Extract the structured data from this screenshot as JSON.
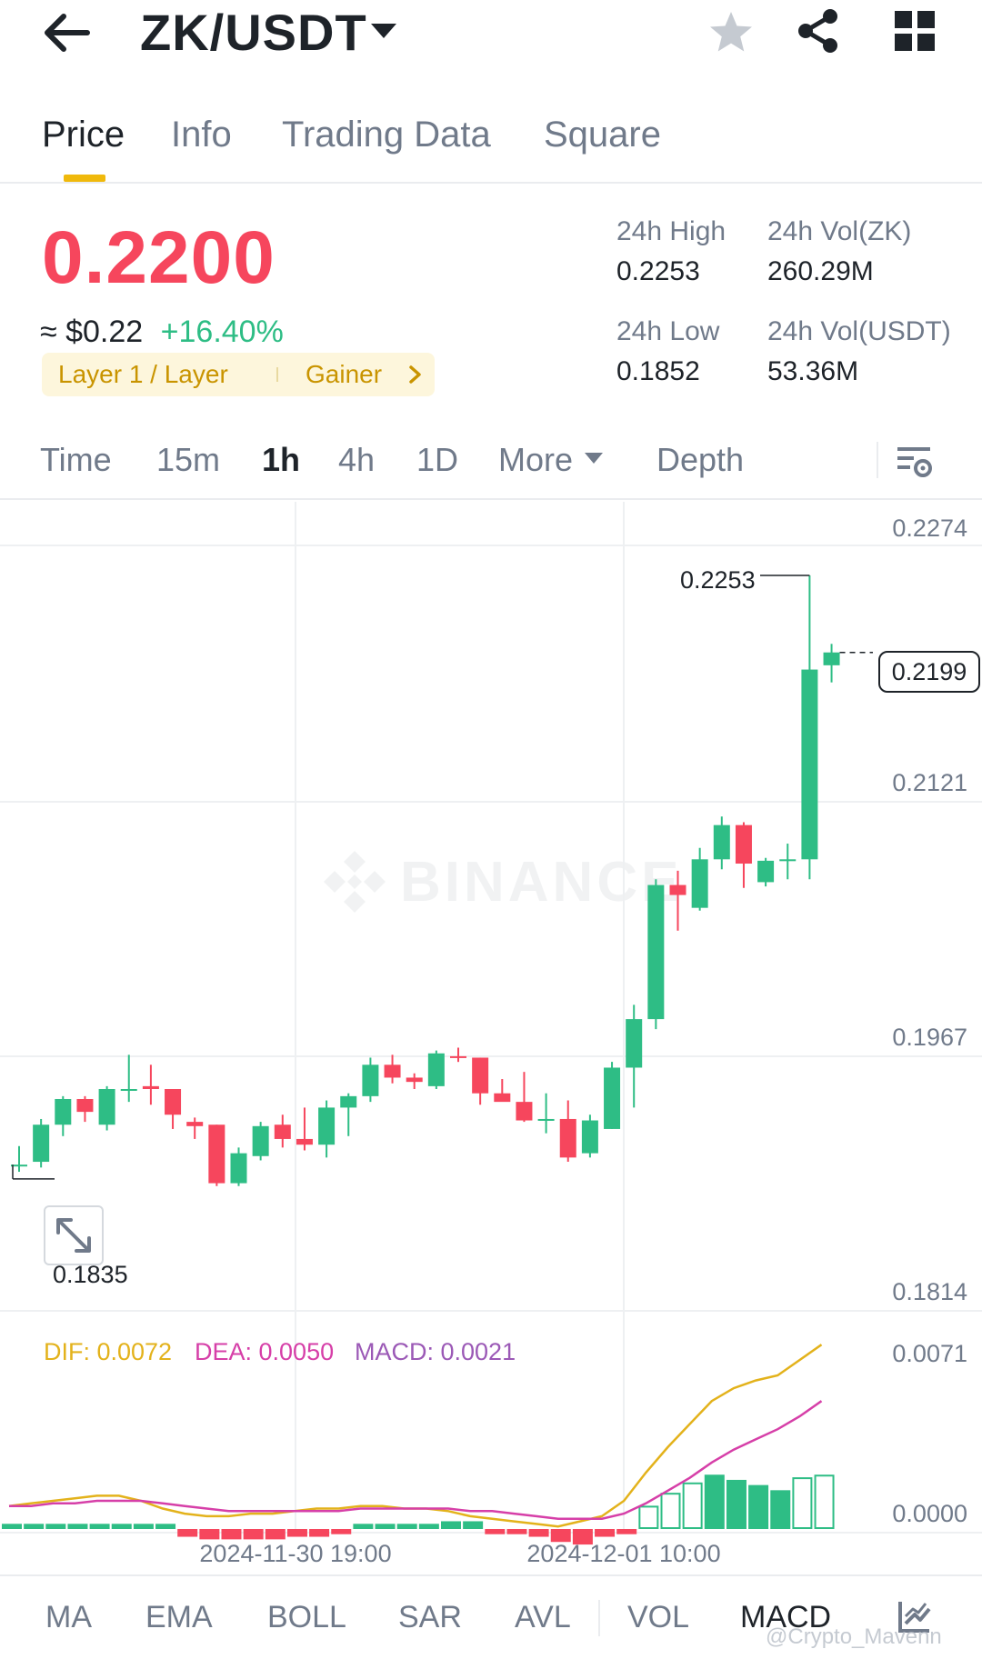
{
  "header": {
    "pair": "ZK/USDT"
  },
  "tabs": [
    {
      "label": "Price",
      "active": true
    },
    {
      "label": "Info",
      "active": false
    },
    {
      "label": "Trading Data",
      "active": false
    },
    {
      "label": "Square",
      "active": false
    }
  ],
  "price": {
    "last": "0.2200",
    "usd": "≈ $0.22",
    "change_pct": "+16.40%",
    "tag_category": "Layer 1 / Layer",
    "tag_rank": "Gainer"
  },
  "stats": {
    "high_label": "24h High",
    "high_value": "0.2253",
    "low_label": "24h Low",
    "low_value": "0.1852",
    "vol_base_label": "24h Vol(ZK)",
    "vol_base_value": "260.29M",
    "vol_quote_label": "24h Vol(USDT)",
    "vol_quote_value": "53.36M"
  },
  "intervals": [
    {
      "label": "Time",
      "active": false
    },
    {
      "label": "15m",
      "active": false
    },
    {
      "label": "1h",
      "active": true
    },
    {
      "label": "4h",
      "active": false
    },
    {
      "label": "1D",
      "active": false
    },
    {
      "label": "More",
      "active": false
    },
    {
      "label": "Depth",
      "active": false
    }
  ],
  "chart": {
    "watermark": "BINANCE",
    "current_price": "0.2199",
    "high_marker": "0.2253",
    "low_marker": "0.1835",
    "macd_dif": "DIF: 0.0072",
    "macd_dea": "DEA: 0.0050",
    "macd_val": "MACD: 0.0021"
  },
  "indicators": [
    {
      "label": "MA",
      "active": false
    },
    {
      "label": "EMA",
      "active": false
    },
    {
      "label": "BOLL",
      "active": false
    },
    {
      "label": "SAR",
      "active": false
    },
    {
      "label": "AVL",
      "active": false
    },
    {
      "label": "VOL",
      "active": false
    },
    {
      "label": "MACD",
      "active": true
    }
  ],
  "footer_watermark": "@Crypto_Mavenn",
  "colors": {
    "up": "#2ebd85",
    "down": "#f6465d",
    "accent": "#f0b90b",
    "dif": "#e3b21b",
    "dea": "#d63fa8",
    "macd": "#9b59b6"
  },
  "chart_data": {
    "type": "candlestick",
    "interval": "1h",
    "price_axis_ticks": [
      "0.2274",
      "0.2121",
      "0.1967",
      "0.1814"
    ],
    "price_range": [
      0.1791,
      0.2274
    ],
    "time_axis_ticks": [
      "2024-11-30 19:00",
      "2024-12-01 10:00"
    ],
    "macd_axis_ticks": [
      "0.0071",
      "0.0000"
    ],
    "candles": [
      {
        "o": 0.184,
        "h": 0.1853,
        "l": 0.1835,
        "c": 0.184
      },
      {
        "o": 0.1842,
        "h": 0.1872,
        "l": 0.1838,
        "c": 0.1868
      },
      {
        "o": 0.1868,
        "h": 0.1888,
        "l": 0.186,
        "c": 0.1886
      },
      {
        "o": 0.1886,
        "h": 0.1888,
        "l": 0.187,
        "c": 0.1877
      },
      {
        "o": 0.1868,
        "h": 0.1895,
        "l": 0.1864,
        "c": 0.1893
      },
      {
        "o": 0.1893,
        "h": 0.1917,
        "l": 0.1884,
        "c": 0.1893
      },
      {
        "o": 0.1895,
        "h": 0.191,
        "l": 0.1882,
        "c": 0.1893
      },
      {
        "o": 0.1893,
        "h": 0.1893,
        "l": 0.1865,
        "c": 0.1875
      },
      {
        "o": 0.187,
        "h": 0.1873,
        "l": 0.1858,
        "c": 0.1867
      },
      {
        "o": 0.1868,
        "h": 0.1868,
        "l": 0.1825,
        "c": 0.1827
      },
      {
        "o": 0.1827,
        "h": 0.1852,
        "l": 0.1825,
        "c": 0.1848
      },
      {
        "o": 0.1846,
        "h": 0.187,
        "l": 0.1843,
        "c": 0.1867
      },
      {
        "o": 0.1868,
        "h": 0.1875,
        "l": 0.1852,
        "c": 0.1858
      },
      {
        "o": 0.1858,
        "h": 0.188,
        "l": 0.185,
        "c": 0.1854
      },
      {
        "o": 0.1854,
        "h": 0.1885,
        "l": 0.1845,
        "c": 0.188
      },
      {
        "o": 0.188,
        "h": 0.189,
        "l": 0.186,
        "c": 0.1888
      },
      {
        "o": 0.1888,
        "h": 0.1915,
        "l": 0.1884,
        "c": 0.191
      },
      {
        "o": 0.191,
        "h": 0.1917,
        "l": 0.1897,
        "c": 0.1901
      },
      {
        "o": 0.1901,
        "h": 0.1904,
        "l": 0.1893,
        "c": 0.1898
      },
      {
        "o": 0.1895,
        "h": 0.192,
        "l": 0.1893,
        "c": 0.1918
      },
      {
        "o": 0.1916,
        "h": 0.1922,
        "l": 0.1912,
        "c": 0.1915
      },
      {
        "o": 0.1915,
        "h": 0.1915,
        "l": 0.1882,
        "c": 0.189
      },
      {
        "o": 0.189,
        "h": 0.19,
        "l": 0.1885,
        "c": 0.1884
      },
      {
        "o": 0.1884,
        "h": 0.1905,
        "l": 0.187,
        "c": 0.1871
      },
      {
        "o": 0.1872,
        "h": 0.189,
        "l": 0.1862,
        "c": 0.1872
      },
      {
        "o": 0.1872,
        "h": 0.1885,
        "l": 0.1842,
        "c": 0.1845
      },
      {
        "o": 0.1848,
        "h": 0.1875,
        "l": 0.1845,
        "c": 0.1871
      },
      {
        "o": 0.1865,
        "h": 0.1912,
        "l": 0.1865,
        "c": 0.1908
      },
      {
        "o": 0.1908,
        "h": 0.1952,
        "l": 0.188,
        "c": 0.1942
      },
      {
        "o": 0.1942,
        "h": 0.204,
        "l": 0.1935,
        "c": 0.2036
      },
      {
        "o": 0.2036,
        "h": 0.2046,
        "l": 0.2004,
        "c": 0.2029
      },
      {
        "o": 0.202,
        "h": 0.2062,
        "l": 0.2018,
        "c": 0.2054
      },
      {
        "o": 0.2054,
        "h": 0.2084,
        "l": 0.2047,
        "c": 0.2078
      },
      {
        "o": 0.2078,
        "h": 0.208,
        "l": 0.2034,
        "c": 0.2051
      },
      {
        "o": 0.2038,
        "h": 0.2055,
        "l": 0.2035,
        "c": 0.2053
      },
      {
        "o": 0.2053,
        "h": 0.2065,
        "l": 0.204,
        "c": 0.2054
      },
      {
        "o": 0.2054,
        "h": 0.2253,
        "l": 0.204,
        "c": 0.2187
      },
      {
        "o": 0.219,
        "h": 0.2205,
        "l": 0.2178,
        "c": 0.2199
      }
    ],
    "macd_histogram": [
      0.0002,
      0.0002,
      0.0002,
      0.0002,
      0.0002,
      0.0002,
      0.0002,
      0.0002,
      -0.0003,
      -0.0004,
      -0.0004,
      -0.0004,
      -0.0004,
      -0.0003,
      -0.0003,
      -0.0002,
      0.0002,
      0.0002,
      0.0002,
      0.0002,
      0.0003,
      0.0003,
      -0.0002,
      -0.0002,
      -0.0003,
      -0.0005,
      -0.0006,
      -0.0003,
      -0.0002,
      0.0009,
      0.0014,
      0.0018,
      0.0021,
      0.0019,
      0.0017,
      0.0015,
      0.002,
      0.0021
    ],
    "dif": [
      0.0009,
      0.001,
      0.0011,
      0.0012,
      0.0013,
      0.0013,
      0.0011,
      0.0008,
      0.0006,
      0.0005,
      0.0005,
      0.0006,
      0.0006,
      0.0007,
      0.0008,
      0.0008,
      0.0009,
      0.0009,
      0.0008,
      0.0008,
      0.0007,
      0.0005,
      0.0004,
      0.0003,
      0.0002,
      0.0001,
      0.0003,
      0.0005,
      0.0011,
      0.0022,
      0.0032,
      0.0041,
      0.005,
      0.0055,
      0.0058,
      0.006,
      0.0066,
      0.0072
    ],
    "dea": [
      0.0009,
      0.0009,
      0.001,
      0.001,
      0.0011,
      0.0011,
      0.0011,
      0.001,
      0.0009,
      0.0008,
      0.0007,
      0.0007,
      0.0007,
      0.0007,
      0.0007,
      0.0007,
      0.0008,
      0.0008,
      0.0008,
      0.0008,
      0.0008,
      0.0007,
      0.0007,
      0.0006,
      0.0005,
      0.0004,
      0.0004,
      0.0004,
      0.0006,
      0.001,
      0.0015,
      0.002,
      0.0026,
      0.0031,
      0.0035,
      0.0039,
      0.0044,
      0.005
    ]
  }
}
